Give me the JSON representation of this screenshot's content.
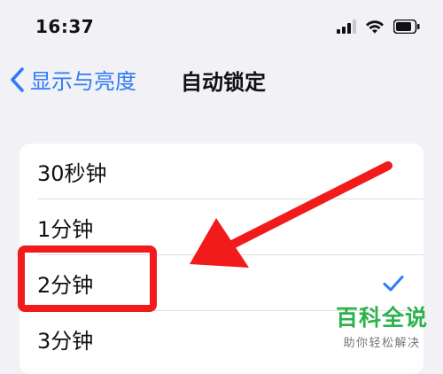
{
  "status_bar": {
    "time": "16:37",
    "icons": [
      "cellular-signal-icon",
      "wifi-icon",
      "battery-icon"
    ]
  },
  "nav": {
    "back_label": "显示与亮度",
    "title": "自动锁定"
  },
  "auto_lock_options": {
    "items": [
      {
        "label": "30秒钟",
        "selected": false
      },
      {
        "label": "1分钟",
        "selected": false
      },
      {
        "label": "2分钟",
        "selected": true
      },
      {
        "label": "3分钟",
        "selected": false
      }
    ]
  },
  "overlay": {
    "annotation_color": "#f21b1b",
    "arrow_icon": "red-arrow-icon"
  },
  "watermark": {
    "main": "百科全说",
    "sub": "助你轻松解决"
  },
  "colors": {
    "accent": "#2f7cf6",
    "background": "#f2f1f6",
    "card": "#ffffff",
    "watermark_green": "#2bb24c"
  }
}
